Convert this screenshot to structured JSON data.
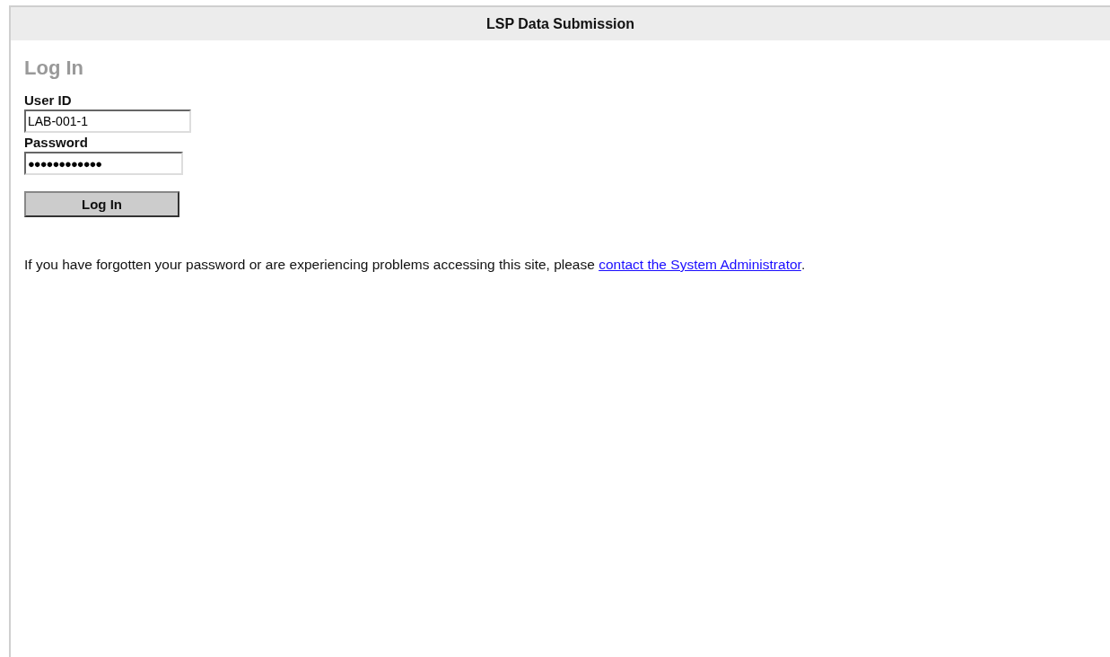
{
  "header": {
    "title": "LSP Data Submission"
  },
  "login": {
    "heading": "Log In",
    "fields": [
      {
        "label": "User ID",
        "value": "LAB-001-1",
        "kind": "text"
      },
      {
        "label": "Password",
        "value": "●●●●●●●●●●●●",
        "kind": "password"
      }
    ],
    "button": "Log In"
  },
  "help": {
    "text": "If you have forgotten your password or are experiencing problems accessing this site, please ",
    "link": "contact the System Administrator",
    "after": "."
  }
}
